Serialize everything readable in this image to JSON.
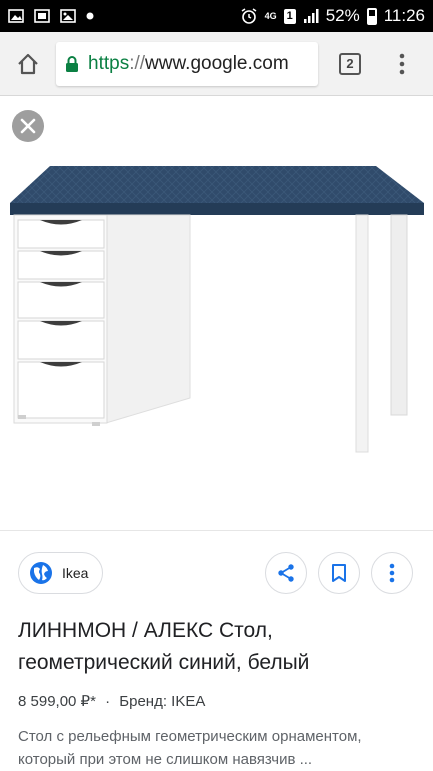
{
  "status_bar": {
    "network": "4G",
    "sim": "1",
    "battery": "52%",
    "time": "11:26"
  },
  "browser": {
    "url_scheme": "https",
    "url_sep": "://",
    "url_host": "www.google.com",
    "tab_count": "2",
    "icons": [
      "home-icon",
      "lock-icon",
      "overflow-menu-icon"
    ]
  },
  "colors": {
    "url_scheme": "#0b8043",
    "desk_top": "#2f4a69",
    "globe": "#1a73e8",
    "action_icon": "#1a73e8"
  },
  "result": {
    "source": "Ikea",
    "title_line1": "ЛИННМОН / АЛЕКС Стол,",
    "title_line2": "геометрический синий, белый",
    "price": "8 599,00 ₽*",
    "dot": "·",
    "brand": "Бренд: IKEA",
    "desc_line1": "Стол с рельефным геометрическим орнаментом,",
    "desc_line2": "который при этом не слишком навязчив ..."
  }
}
